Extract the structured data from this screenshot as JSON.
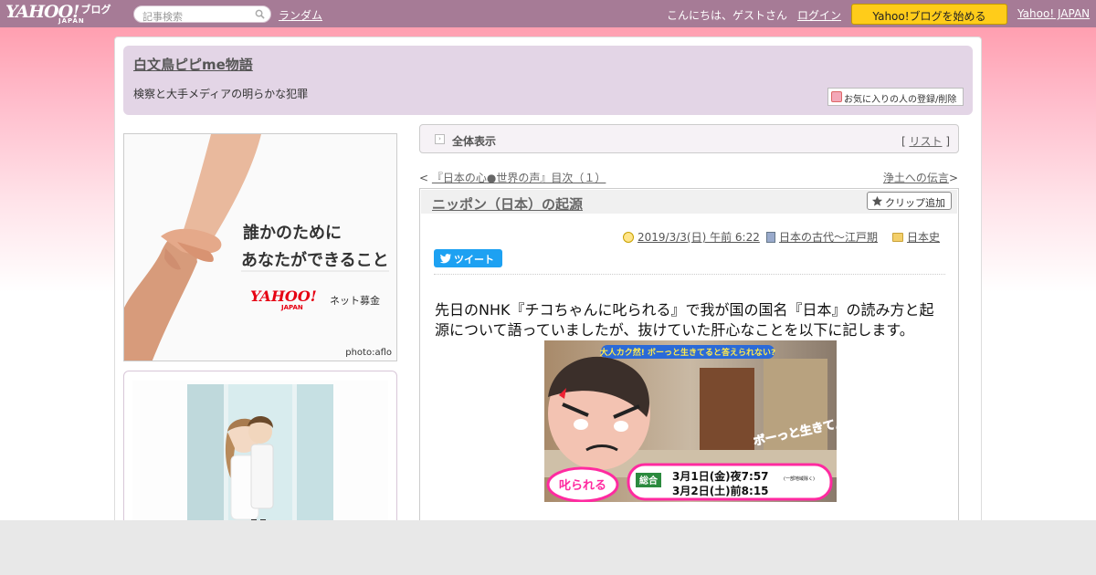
{
  "topbar": {
    "logo_main": "YAHOO!",
    "logo_japan": "JAPAN",
    "logo_blog": "ブログ",
    "search_placeholder": "記事検索",
    "random_link": "ランダム",
    "greeting": "こんにちは、ゲストさん",
    "login_link": "ログイン",
    "start_button": "Yahoo!ブログを始める",
    "yahoo_japan_link": "Yahoo! JAPAN"
  },
  "blog": {
    "title": "白文鳥ピピme物語",
    "description": "検察と大手メディアの明らかな犯罪",
    "favorite_button": "お気に入りの人の登録/削除"
  },
  "sidebar": {
    "ad": {
      "line1": "誰かのために",
      "line2": "あなたができること",
      "logo": "YAHOO!",
      "logo_japan": "JAPAN",
      "brand": "ネット募金",
      "credit": "photo:aflo"
    }
  },
  "nav": {
    "label": "全体表示",
    "list_open": "[",
    "list_link": "リスト",
    "list_close": "]"
  },
  "pager": {
    "prev_arrow": "<",
    "prev_title": "『日本の心●世界の声』目次（１）",
    "next_title": "浄土への伝言",
    "next_arrow": ">"
  },
  "article": {
    "title": "ニッポン（日本）の起源",
    "clip_button": "クリップ追加",
    "date": "2019/3/3(日) 午前 6:22",
    "category": "日本の古代～江戸期",
    "folder": "日本史",
    "tweet_button": "ツイート",
    "body": "先日のNHK『チコちゃんに叱られる』で我が国の国名『日本』の読み方と起源について語っていましたが、抜けていた肝心なことを以下に記します。",
    "image": {
      "banner": "大人カク然! ボーっと生きてると答えられない?",
      "channel": "総合",
      "date1": "3月1日(金)夜7:57",
      "date1_note": "(一部地域除く)",
      "date2": "3月2日(土)前8:15",
      "slogan": "ボーっと生きてんじゃ"
    }
  },
  "colors": {
    "topbar": "#a67b96",
    "header_box": "#e3d5e6",
    "start_button": "#ffcc1a",
    "tweet": "#1da1f2"
  }
}
